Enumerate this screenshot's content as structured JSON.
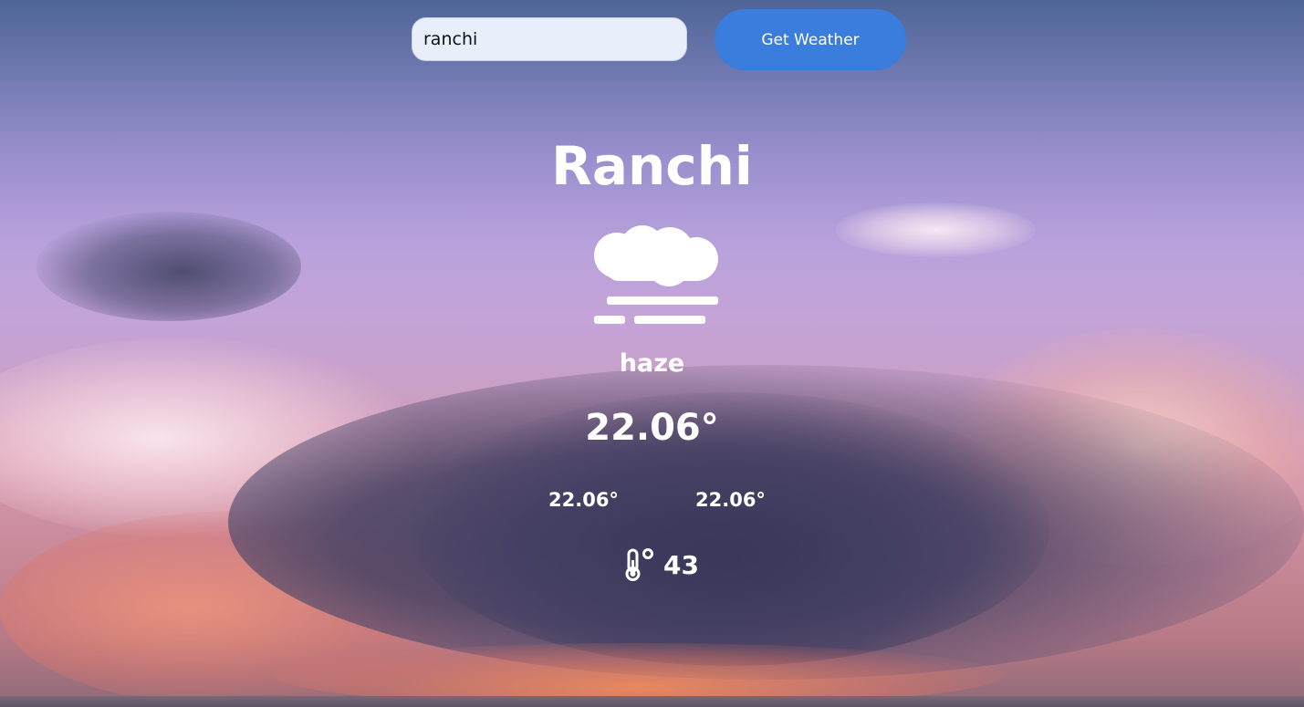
{
  "search": {
    "value": "ranchi",
    "button_label": "Get Weather"
  },
  "weather": {
    "city": "Ranchi",
    "icon": "haze-icon",
    "condition": "haze",
    "temperature": "22.06°",
    "temp_min": "22.06°",
    "temp_max": "22.06°",
    "humidity_icon": "thermometer-icon",
    "humidity": "43"
  },
  "colors": {
    "button": "#3a7ddc",
    "input_bg": "#e8effb",
    "text": "#ffffff"
  }
}
